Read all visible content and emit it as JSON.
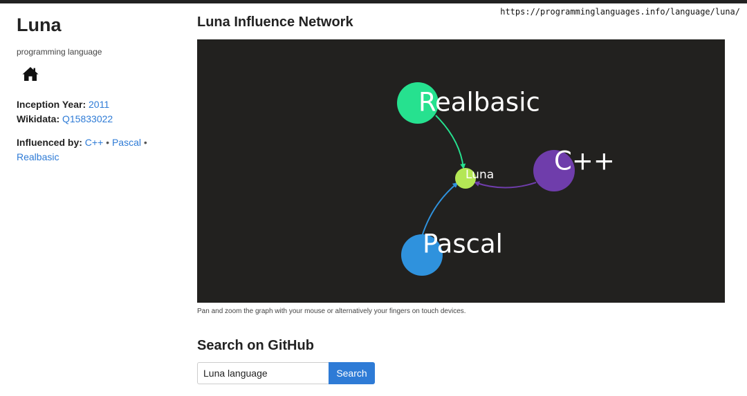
{
  "url": "https://programminglanguages.info/language/luna/",
  "sidebar": {
    "title": "Luna",
    "subtitle": "programming language",
    "home_icon": "home-icon",
    "inception_label": "Inception Year:",
    "inception_value": "2011",
    "wikidata_label": "Wikidata:",
    "wikidata_value": "Q15833022",
    "influenced_label": "Influenced by:",
    "influences": [
      "C++",
      "Pascal",
      "Realbasic"
    ]
  },
  "main": {
    "network_title": "Luna Influence Network",
    "graph": {
      "background": "#22211f",
      "nodes": [
        {
          "id": "realbasic",
          "label": "Realbasic",
          "color": "#26e18f"
        },
        {
          "id": "cpp",
          "label": "C++",
          "color": "#6f3dab"
        },
        {
          "id": "pascal",
          "label": "Pascal",
          "color": "#2f92dd"
        },
        {
          "id": "luna",
          "label": "Luna",
          "color": "#b4e755"
        }
      ]
    },
    "caption": "Pan and zoom the graph with your mouse or alternatively your fingers on touch devices.",
    "github_title": "Search on GitHub",
    "search_value": "Luna language",
    "search_button": "Search"
  }
}
